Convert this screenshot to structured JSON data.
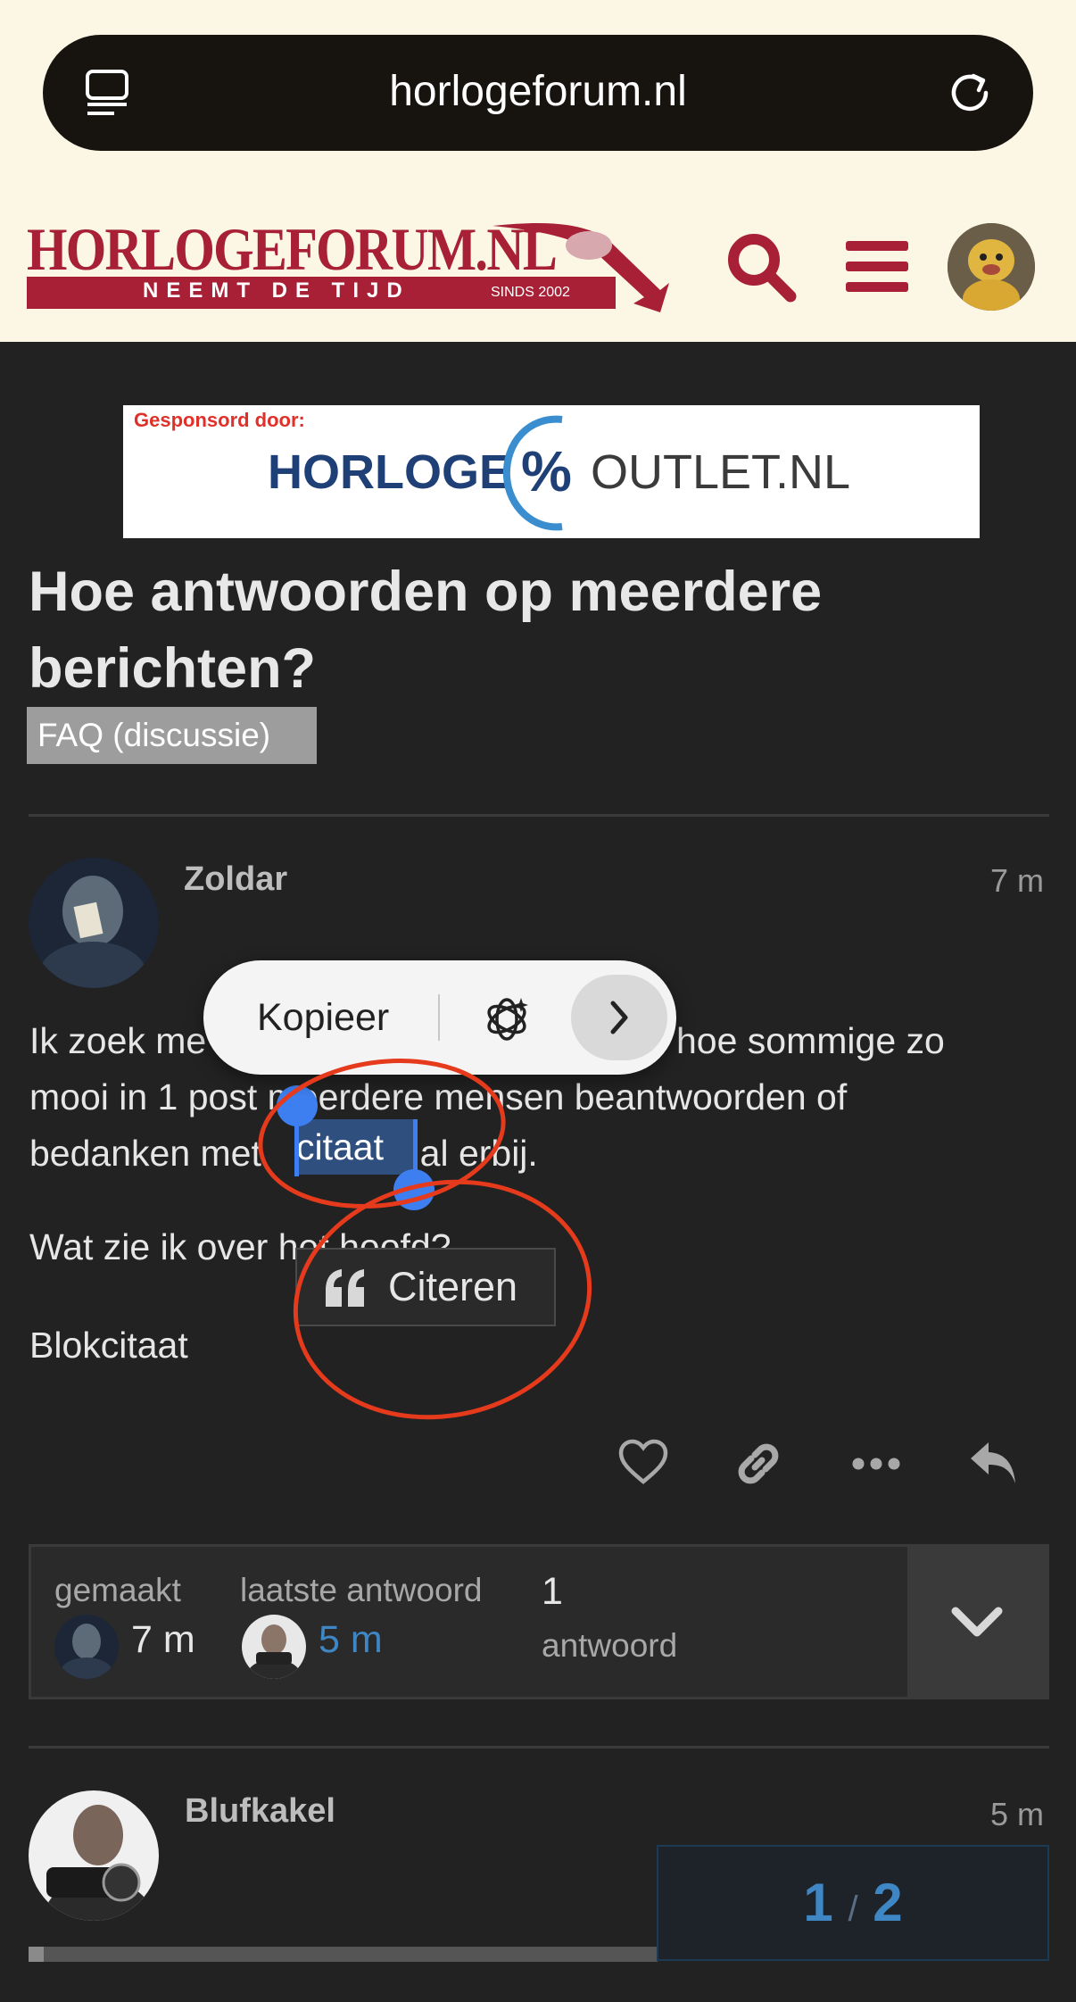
{
  "browser": {
    "url": "horlogeforum.nl"
  },
  "site": {
    "logo_title": "HORLOGEFORUM.NL",
    "logo_subtitle": "NEEMT DE TIJD",
    "logo_since": "SINDS 2002",
    "brand_color": "#a82035"
  },
  "banner": {
    "sponsor_label": "Gesponsord door:",
    "brand_left": "HORLOGE",
    "brand_right": "OUTLET.NL"
  },
  "topic": {
    "title": "Hoe antwoorden op meerdere berichten?",
    "category": "FAQ (discussie)"
  },
  "post1": {
    "username": "Zoldar",
    "time": "7 m",
    "line1_start": "Ik zoek me",
    "line1_end": "hoe sommige zo",
    "line2": "mooi in 1 post meerdere mensen beantwoorden of",
    "line3_start": "bedanken met ",
    "line3_selected": "citaat",
    "line3_end": " en al erbij.",
    "line4": "Wat zie ik over het hoofd?",
    "line5": "Blokcitaat"
  },
  "context_menu": {
    "copy_label": "Kopieer"
  },
  "quote_button": {
    "label": "Citeren"
  },
  "topic_map": {
    "created_label": "gemaakt",
    "created_value": "7 m",
    "last_reply_label": "laatste antwoord",
    "last_reply_value": "5 m",
    "replies_count": "1",
    "replies_label": "antwoord"
  },
  "post2": {
    "username": "Blufkakel",
    "time": "5 m"
  },
  "progress": {
    "current": "1",
    "separator": "/",
    "total": "2"
  }
}
